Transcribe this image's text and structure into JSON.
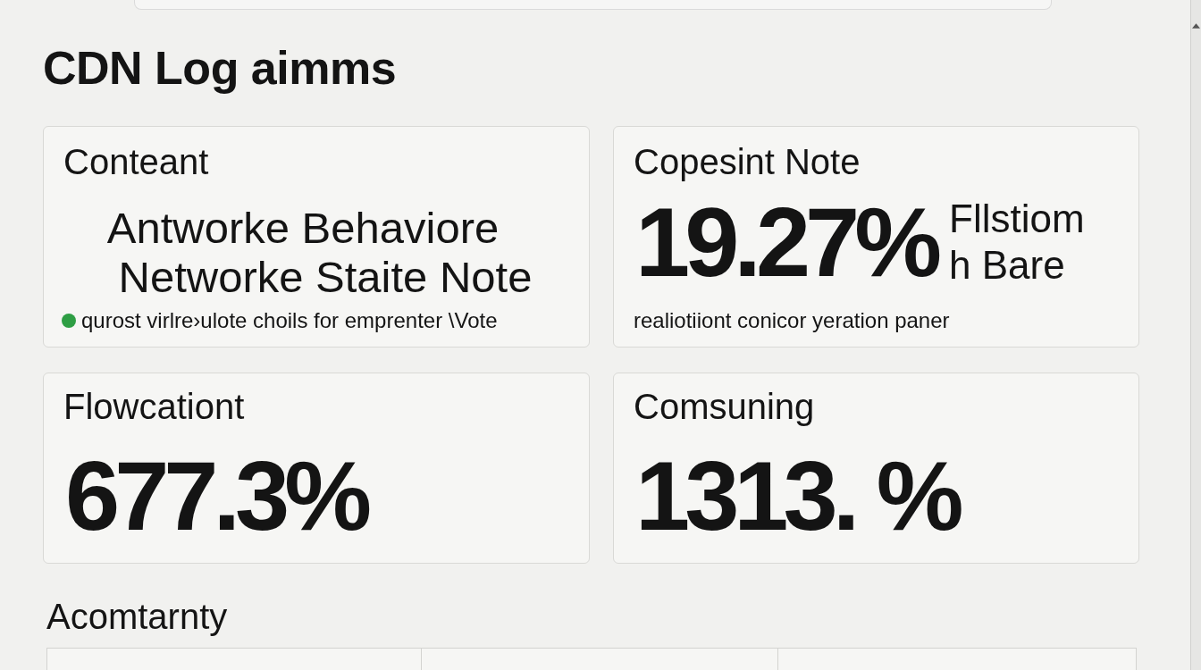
{
  "title": "CDN Log aimms",
  "cards": [
    {
      "kind": "text",
      "label": "Conteant",
      "lines": [
        "Antworke Behaviore",
        "Networke Staite Note"
      ],
      "note": {
        "text": "qurost virlre›ulote choils for emprenter \\Vote",
        "color": "#2e9e44"
      }
    },
    {
      "kind": "stat",
      "label": "Copesint Note",
      "value": "19.27%",
      "side_lines": [
        "Fllstiom",
        "h Bare"
      ],
      "note": {
        "text": "realiotiiont conicor yeration paner"
      }
    },
    {
      "kind": "stat",
      "label": "Flowcationt",
      "value": "677.3%"
    },
    {
      "kind": "stat",
      "label": "Comsuning",
      "value": "1313. %"
    }
  ],
  "section": {
    "title": "Acomtarnty"
  }
}
